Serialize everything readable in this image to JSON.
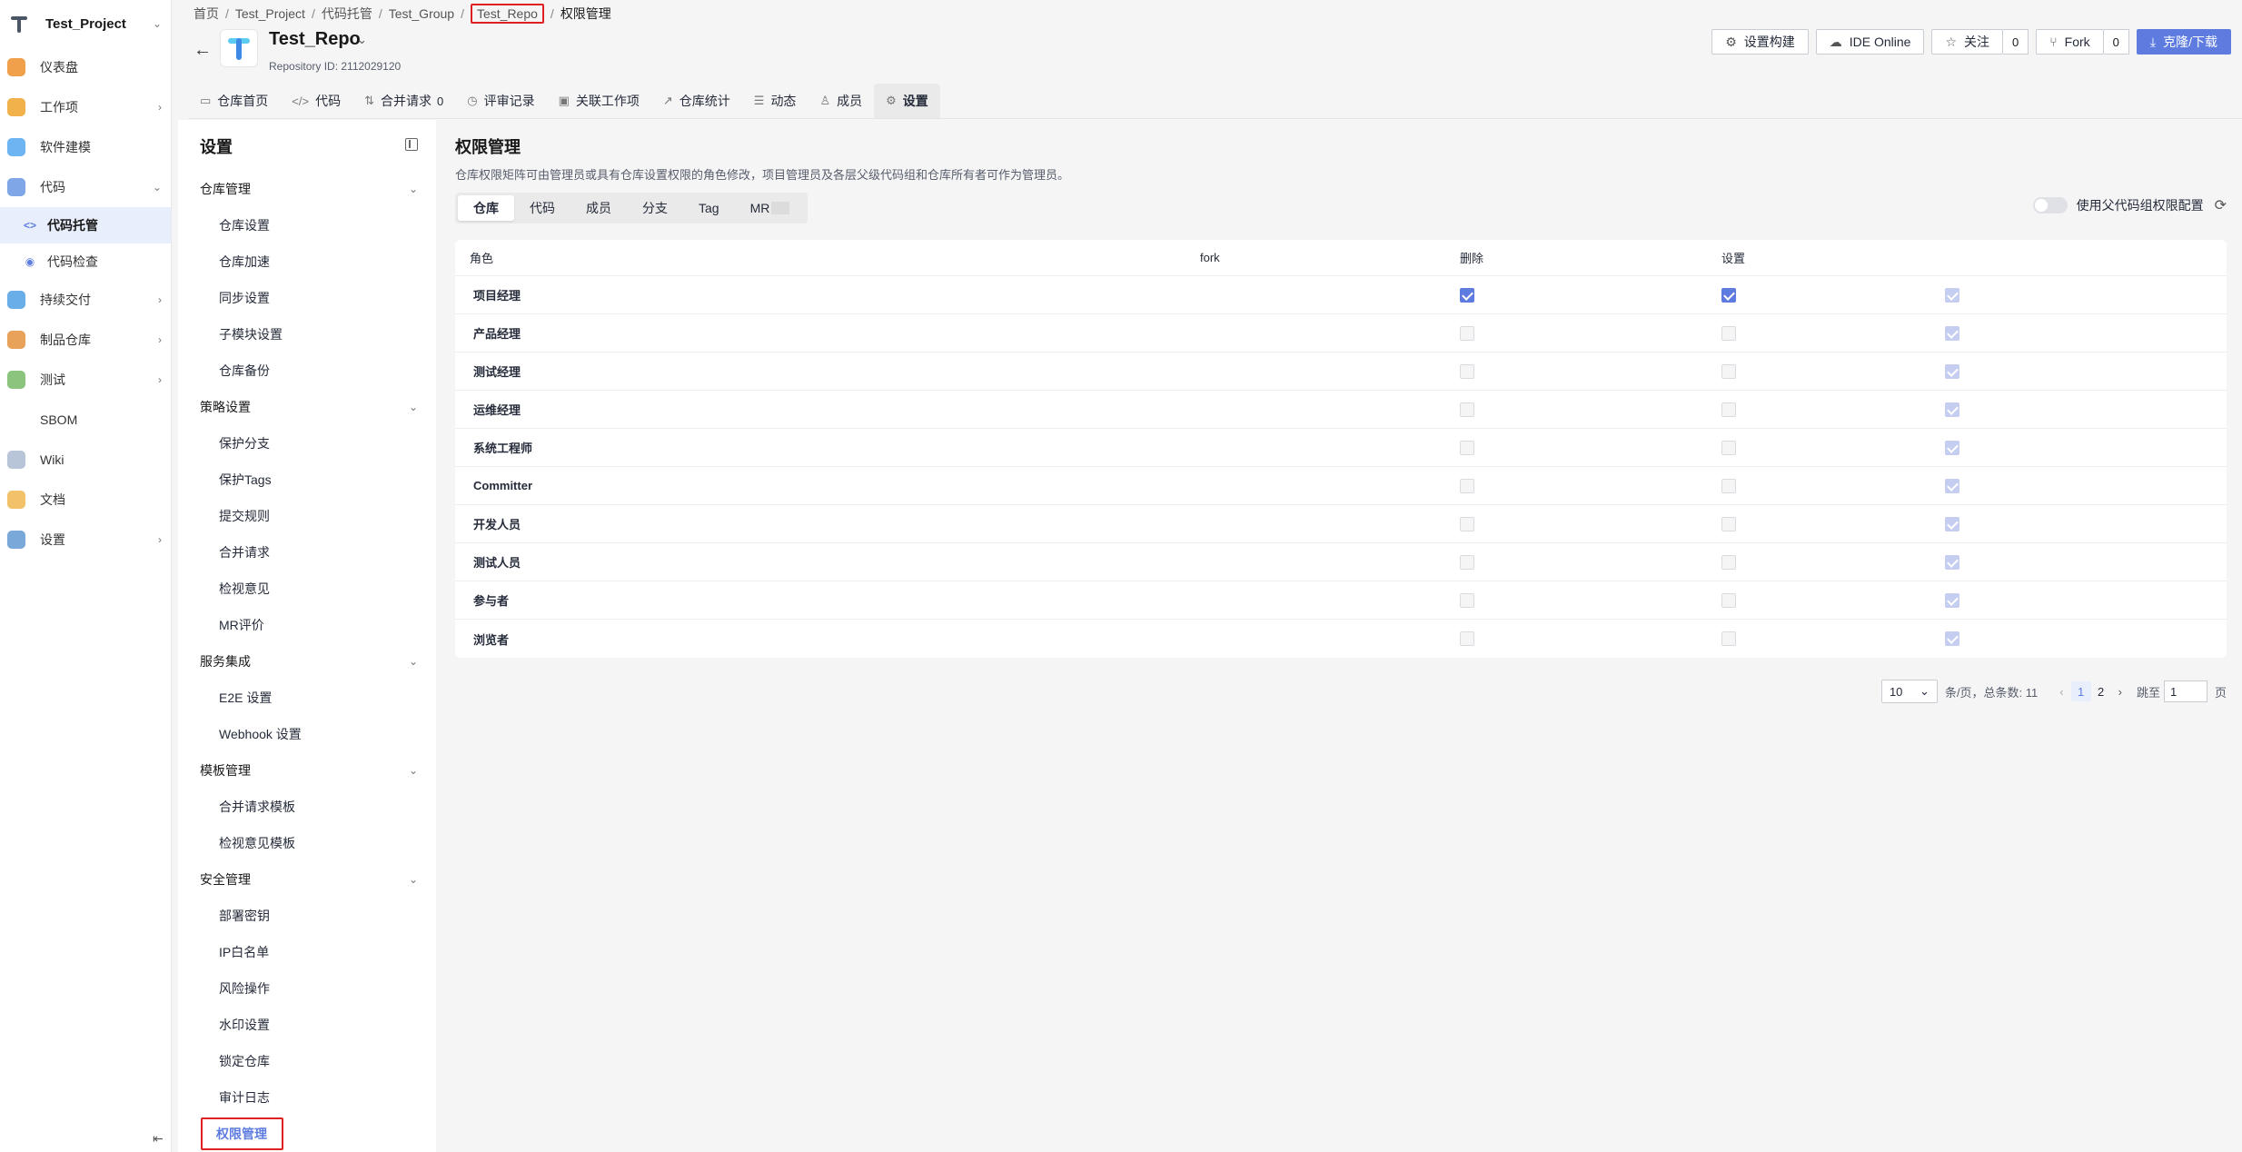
{
  "leftnav": {
    "project_name": "Test_Project",
    "items": [
      {
        "label": "仪表盘",
        "icon": "dashboard-icon",
        "color": "#f0a04b",
        "chev": ""
      },
      {
        "label": "工作项",
        "icon": "workitem-icon",
        "color": "#f2b24b",
        "chev": "›"
      },
      {
        "label": "软件建模",
        "icon": "modeling-icon",
        "color": "#6cb4f2",
        "chev": ""
      },
      {
        "label": "代码",
        "icon": "code-icon",
        "color": "#7fa7e8",
        "chev": "⌄"
      }
    ],
    "subitems": [
      {
        "label": "代码托管",
        "icon": "code-hosting-icon",
        "glyph": "<>"
      },
      {
        "label": "代码检查",
        "icon": "code-check-icon",
        "glyph": "◉"
      }
    ],
    "items2": [
      {
        "label": "持续交付",
        "icon": "delivery-icon",
        "color": "#6aaee8",
        "chev": "›"
      },
      {
        "label": "制品仓库",
        "icon": "artifact-icon",
        "color": "#e8a25a",
        "chev": "›"
      },
      {
        "label": "测试",
        "icon": "test-icon",
        "color": "#8bc47c",
        "chev": "›"
      },
      {
        "label": "SBOM",
        "icon": "",
        "color": "transparent",
        "chev": ""
      },
      {
        "label": "Wiki",
        "icon": "wiki-icon",
        "color": "#b8c4d8",
        "chev": ""
      },
      {
        "label": "文档",
        "icon": "docs-icon",
        "color": "#f2c26b",
        "chev": ""
      },
      {
        "label": "设置",
        "icon": "settings-icon",
        "color": "#7aa8d8",
        "chev": "›"
      }
    ]
  },
  "breadcrumb": [
    "首页",
    "Test_Project",
    "代码托管",
    "Test_Group",
    "Test_Repo",
    "权限管理"
  ],
  "repo": {
    "name": "Test_Repo",
    "id_label": "Repository ID: 2112029120"
  },
  "header_buttons": {
    "build": "设置构建",
    "ide": "IDE Online",
    "watch": "关注",
    "watch_count": "0",
    "fork": "Fork",
    "fork_count": "0",
    "clone": "克隆/下载"
  },
  "tabs": [
    {
      "label": "仓库首页",
      "icon": "▭",
      "badge": ""
    },
    {
      "label": "代码",
      "icon": "</>",
      "badge": ""
    },
    {
      "label": "合并请求",
      "icon": "⇅",
      "badge": "0"
    },
    {
      "label": "评审记录",
      "icon": "◷",
      "badge": ""
    },
    {
      "label": "关联工作项",
      "icon": "▣",
      "badge": ""
    },
    {
      "label": "仓库统计",
      "icon": "↗",
      "badge": ""
    },
    {
      "label": "动态",
      "icon": "☰",
      "badge": ""
    },
    {
      "label": "成员",
      "icon": "♙",
      "badge": ""
    },
    {
      "label": "设置",
      "icon": "⚙",
      "badge": ""
    }
  ],
  "settings_menu": {
    "title": "设置",
    "groups": [
      {
        "label": "仓库管理",
        "items": [
          "仓库设置",
          "仓库加速",
          "同步设置",
          "子模块设置",
          "仓库备份"
        ]
      },
      {
        "label": "策略设置",
        "items": [
          "保护分支",
          "保护Tags",
          "提交规则",
          "合并请求",
          "检视意见",
          "MR评价"
        ]
      },
      {
        "label": "服务集成",
        "items": [
          "E2E 设置",
          "Webhook 设置"
        ]
      },
      {
        "label": "模板管理",
        "items": [
          "合并请求模板",
          "检视意见模板"
        ]
      },
      {
        "label": "安全管理",
        "items": [
          "部署密钥",
          "IP白名单",
          "风险操作",
          "水印设置",
          "锁定仓库",
          "审计日志",
          "权限管理"
        ]
      }
    ]
  },
  "main": {
    "title": "权限管理",
    "desc": "仓库权限矩阵可由管理员或具有仓库设置权限的角色修改，项目管理员及各层父级代码组和仓库所有者可作为管理员。",
    "subtabs": [
      "仓库",
      "代码",
      "成员",
      "分支",
      "Tag",
      "MR"
    ],
    "toggle_label": "使用父代码组权限配置"
  },
  "table": {
    "headers": [
      "角色",
      "fork",
      "删除",
      "设置"
    ],
    "rows": [
      {
        "role": "项目经理",
        "fork": "dis-on",
        "delete": "on",
        "settings": "on"
      },
      {
        "role": "产品经理",
        "fork": "dis-on",
        "delete": "dis-off",
        "settings": "dis-off"
      },
      {
        "role": "测试经理",
        "fork": "dis-on",
        "delete": "dis-off",
        "settings": "dis-off"
      },
      {
        "role": "运维经理",
        "fork": "dis-on",
        "delete": "dis-off",
        "settings": "dis-off"
      },
      {
        "role": "系统工程师",
        "fork": "dis-on",
        "delete": "dis-off",
        "settings": "dis-off"
      },
      {
        "role": "Committer",
        "fork": "dis-on",
        "delete": "dis-off",
        "settings": "dis-off"
      },
      {
        "role": "开发人员",
        "fork": "dis-on",
        "delete": "dis-off",
        "settings": "dis-off"
      },
      {
        "role": "测试人员",
        "fork": "dis-on",
        "delete": "dis-off",
        "settings": "dis-off"
      },
      {
        "role": "参与者",
        "fork": "dis-on",
        "delete": "dis-off",
        "settings": "dis-off"
      },
      {
        "role": "浏览者",
        "fork": "dis-on",
        "delete": "dis-off",
        "settings": "dis-off"
      }
    ]
  },
  "pager": {
    "page_size": "10",
    "total_label": "条/页，总条数: 11",
    "pages": [
      "1",
      "2"
    ],
    "jump_label": "跳至",
    "jump_value": "1",
    "page_unit": "页"
  }
}
